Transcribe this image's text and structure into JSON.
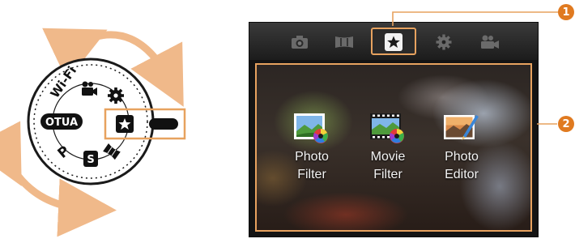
{
  "dial": {
    "labels": {
      "wifi": "Wi-Fi",
      "auto": "AUTO",
      "p": "P",
      "s": "S"
    },
    "icons": [
      "movie-camera-icon",
      "gear-icon",
      "star-icon",
      "panorama-icon",
      "smart-s-icon"
    ],
    "rotate_arrow_color": "#f0b98a",
    "highlight_color": "#e7a25f"
  },
  "screen": {
    "tabs": [
      {
        "name": "camera-icon",
        "active": false
      },
      {
        "name": "panorama-icon",
        "active": false
      },
      {
        "name": "star-icon",
        "active": true
      },
      {
        "name": "gear-icon",
        "active": false
      },
      {
        "name": "movie-camera-icon",
        "active": false
      }
    ],
    "apps": [
      {
        "label": "Photo\nFilter",
        "icon": "photo-filter-icon"
      },
      {
        "label": "Movie\nFilter",
        "icon": "movie-filter-icon"
      },
      {
        "label": "Photo\nEditor",
        "icon": "photo-editor-icon"
      }
    ]
  },
  "callouts": {
    "one": "1",
    "two": "2",
    "color": "#e07a20"
  }
}
